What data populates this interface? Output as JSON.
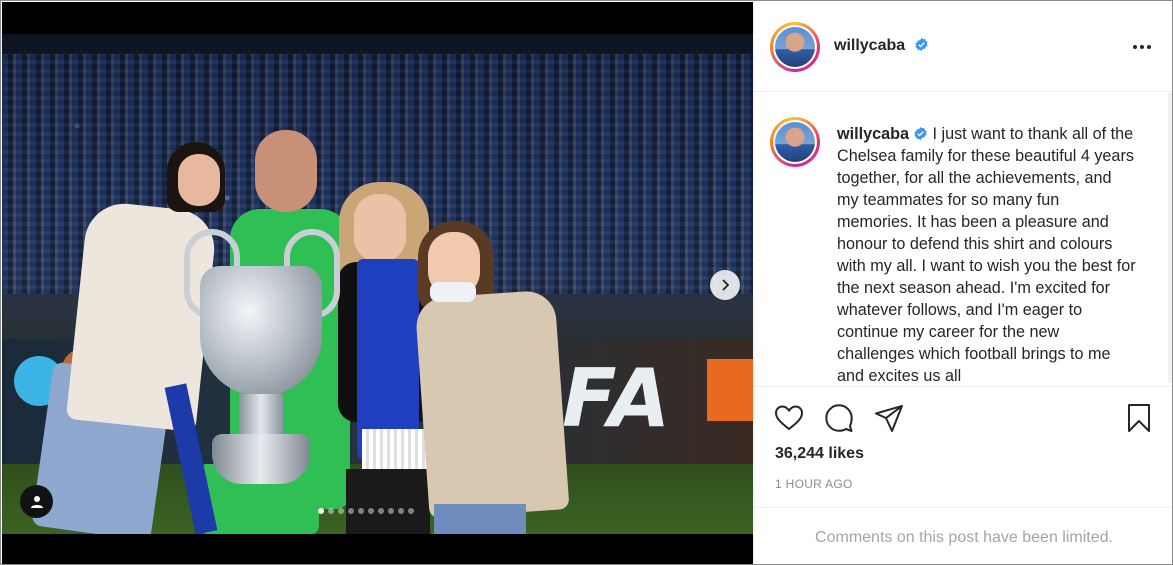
{
  "post": {
    "username": "willycaba",
    "caption": "I just want to thank all of the Chelsea family for these beautiful 4 years together, for all the achievements, and my teammates for so many fun memories. It has been a pleasure and honour to defend this shirt and colours with my all. I want to wish you the best for the next season ahead. I'm excited for whatever follows, and I'm eager to continue my career for the new challenges which football brings to me and excites us all",
    "likes": "36,244 likes",
    "time": "1 HOUR AGO",
    "comments_notice": "Comments on this post have been limited.",
    "verified_color": "#3897f0"
  },
  "media": {
    "board_text": "FA",
    "carousel_index": 1,
    "carousel_total": 10
  },
  "icons": {
    "like": "heart-icon",
    "comment": "comment-icon",
    "share": "share-icon",
    "save": "bookmark-icon",
    "more": "more-icon",
    "next": "chevron-right-icon",
    "tag": "user-icon"
  }
}
